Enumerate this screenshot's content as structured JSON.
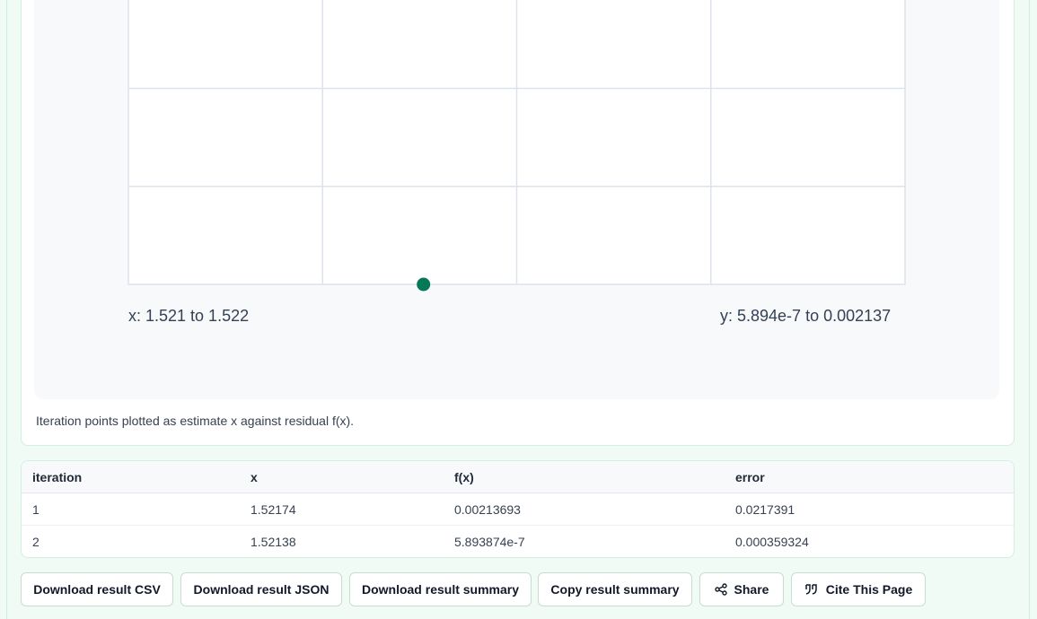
{
  "chart": {
    "x_range_text": "x: 1.521 to 1.522",
    "y_range_text": "y: 5.894e-7 to 0.002137",
    "caption": "Iteration points plotted as estimate x against residual f(x).",
    "point_color": "#047857"
  },
  "chart_data": {
    "type": "scatter",
    "x": [
      1.52174,
      1.52138
    ],
    "y": [
      0.00213693,
      5.893874e-07
    ],
    "xlim": [
      1.521,
      1.522
    ],
    "ylim": [
      5.894e-07,
      0.002137
    ],
    "grid": true
  },
  "table": {
    "headers": [
      "iteration",
      "x",
      "f(x)",
      "error"
    ],
    "rows": [
      [
        "1",
        "1.52174",
        "0.00213693",
        "0.0217391"
      ],
      [
        "2",
        "1.52138",
        "5.893874e-7",
        "0.000359324"
      ]
    ]
  },
  "buttons": {
    "download_csv": "Download result CSV",
    "download_json": "Download result JSON",
    "download_summary": "Download result summary",
    "copy_summary": "Copy result summary",
    "share": "Share",
    "cite": "Cite This Page",
    "share_icon": "share-icon",
    "cite_icon": "quote-icon"
  }
}
